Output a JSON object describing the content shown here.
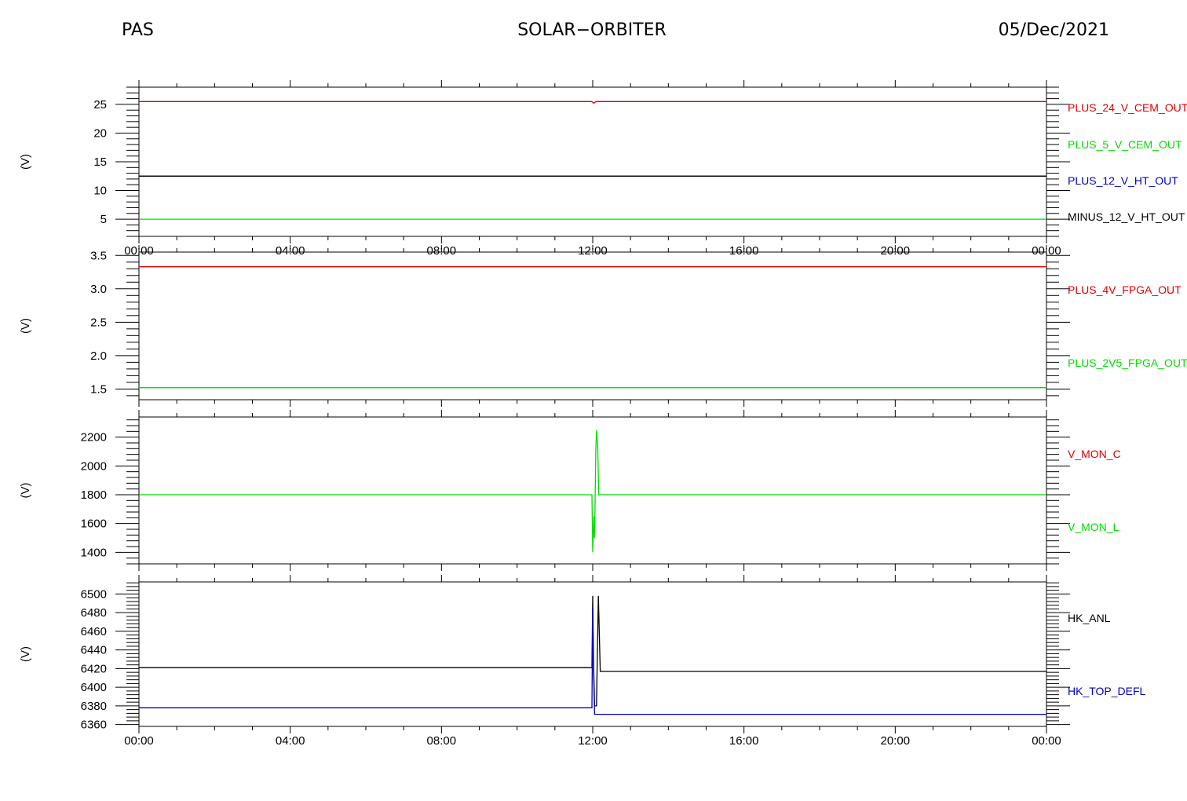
{
  "header": {
    "instrument": "PAS",
    "mission": "SOLAR−ORBITER",
    "date": "05/Dec/2021"
  },
  "colors": {
    "red": "#e00000",
    "green": "#00dd00",
    "blue": "#0000c0",
    "black": "#000000"
  },
  "chart_data": [
    {
      "type": "line",
      "ylabel": "(V)",
      "ylim": [
        2,
        28
      ],
      "yticks": [
        5,
        10,
        15,
        20,
        25
      ],
      "xlim": [
        0,
        24
      ],
      "xtick_labels": [
        "00:00",
        "04:00",
        "08:00",
        "12:00",
        "16:00",
        "20:00",
        "00:00"
      ],
      "series": [
        {
          "name": "PLUS_24_V_CEM_OUT",
          "color": "red",
          "x": [
            0,
            11.98,
            12.03,
            12.08,
            12.13,
            24
          ],
          "y": [
            25.5,
            25.5,
            25.2,
            25.5,
            25.5,
            25.5
          ]
        },
        {
          "name": "PLUS_5_V_CEM_OUT",
          "color": "green",
          "x": [
            0,
            24
          ],
          "y": [
            5.0,
            5.0
          ]
        },
        {
          "name": "PLUS_12_V_HT_OUT",
          "color": "blue",
          "x": [
            0,
            24
          ],
          "y": [
            12.5,
            12.5
          ]
        },
        {
          "name": "MINUS_12_V_HT_OUT",
          "color": "black",
          "x": [
            0,
            24
          ],
          "y": [
            12.5,
            12.5
          ]
        }
      ]
    },
    {
      "type": "line",
      "ylabel": "(V)",
      "ylim": [
        1.34,
        3.55
      ],
      "yticks": [
        1.5,
        2.0,
        2.5,
        3.0,
        3.5
      ],
      "ytick_labels": [
        "1.5",
        "2.0",
        "2.5",
        "3.0",
        "3.5"
      ],
      "xlim": [
        0,
        24
      ],
      "xtick_labels": [],
      "series": [
        {
          "name": "PLUS_4V_FPGA_OUT",
          "color": "red",
          "x": [
            0,
            24
          ],
          "y": [
            3.33,
            3.33
          ]
        },
        {
          "name": "PLUS_2V5_FPGA_OUT",
          "color": "green",
          "x": [
            0,
            24
          ],
          "y": [
            1.52,
            1.52
          ]
        }
      ]
    },
    {
      "type": "line",
      "ylabel": "(V)",
      "ylim": [
        1320,
        2340
      ],
      "yticks": [
        1400,
        1600,
        1800,
        2000,
        2200
      ],
      "xlim": [
        0,
        24
      ],
      "xtick_labels": [],
      "series": [
        {
          "name": "V_MON_C",
          "color": "red",
          "x": [],
          "y": []
        },
        {
          "name": "V_MON_L",
          "color": "green",
          "x": [
            0,
            11.98,
            12.0,
            12.03,
            12.05,
            12.08,
            12.1,
            12.13,
            12.16,
            12.2,
            24
          ],
          "y": [
            1800,
            1800,
            1400,
            1650,
            1500,
            2100,
            2250,
            2150,
            1800,
            1800,
            1800
          ]
        }
      ]
    },
    {
      "type": "line",
      "ylabel": "(V)",
      "ylim": [
        6358,
        6513
      ],
      "yticks": [
        6360,
        6380,
        6400,
        6420,
        6440,
        6460,
        6480,
        6500
      ],
      "xlim": [
        0,
        24
      ],
      "xtick_labels": [
        "00:00",
        "04:00",
        "08:00",
        "12:00",
        "16:00",
        "20:00",
        "00:00"
      ],
      "series": [
        {
          "name": "HK_ANL",
          "color": "black",
          "x": [
            0,
            11.98,
            12.0,
            12.02,
            12.05,
            12.1,
            12.15,
            12.2,
            24
          ],
          "y": [
            6421,
            6421,
            6498,
            6430,
            6380,
            6380,
            6498,
            6417,
            6417
          ]
        },
        {
          "name": "HK_TOP_DEFL",
          "color": "blue",
          "x": [
            0,
            11.98,
            12.0,
            12.02,
            12.05,
            12.2,
            24
          ],
          "y": [
            6378,
            6378,
            6485,
            6420,
            6371,
            6371,
            6371
          ]
        }
      ]
    }
  ]
}
